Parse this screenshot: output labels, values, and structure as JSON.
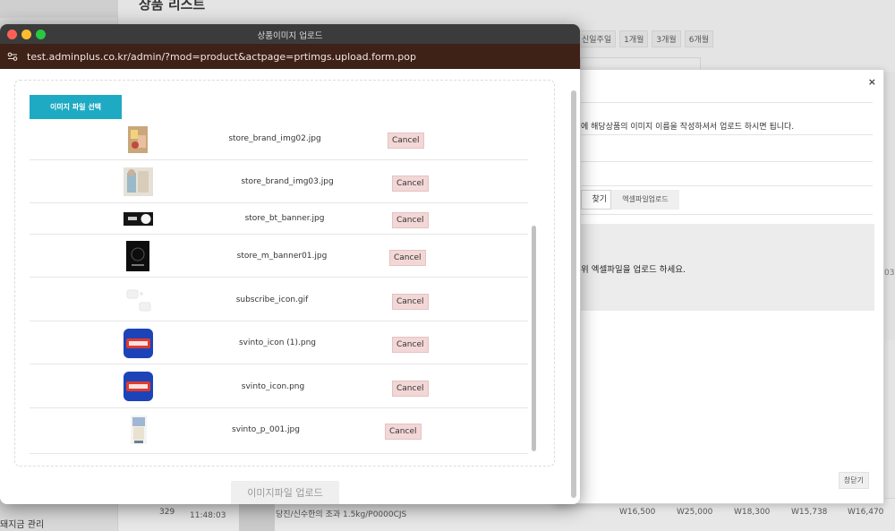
{
  "background": {
    "page_title": "상품 리스트",
    "period_buttons": [
      "신일주일",
      "1개월",
      "3개월",
      "6개월"
    ],
    "sidebar_label": "돼지금 관리",
    "row": {
      "no": "329",
      "time": "11:48:03",
      "product": "당진/신수한의 조과 1.5kg/P0000CJS",
      "prices": [
        "W16,500",
        "W25,000",
        "W18,300",
        "W15,738",
        "W16,470"
      ]
    },
    "right_edge_label": "03"
  },
  "dialog": {
    "close_label": "×",
    "description": "에 해당상품의 이미지 이름을 작성하셔서 업로드 하시면 됩니다.",
    "tab_find": "찾기",
    "tab_excel": "엑셀파일업로드",
    "notice": "위 엑셀파일을 업로드 하세요.",
    "close_button": "창닫기"
  },
  "popup": {
    "window_title": "상품이미지 업로드",
    "url": "test.adminplus.co.kr/admin/?mod=product&actpage=prtimgs.upload.form.pop",
    "select_button": "이미지 파일 선택",
    "upload_button": "이미지파일 업로드",
    "files": [
      {
        "name": "store_brand_img02.jpg",
        "cancel": "Cancel",
        "thumb": "brand-photo-thumb"
      },
      {
        "name": "store_brand_img03.jpg",
        "cancel": "Cancel",
        "thumb": "brand-photo-thumb"
      },
      {
        "name": "store_bt_banner.jpg",
        "cancel": "Cancel",
        "thumb": "dark-banner-thumb"
      },
      {
        "name": "store_m_banner01.jpg",
        "cancel": "Cancel",
        "thumb": "dark-banner-thumb"
      },
      {
        "name": "subscribe_icon.gif",
        "cancel": "Cancel",
        "thumb": "white-icon-thumb"
      },
      {
        "name": "svinto_icon (1).png",
        "cancel": "Cancel",
        "thumb": "svinto-logo-thumb"
      },
      {
        "name": "svinto_icon.png",
        "cancel": "Cancel",
        "thumb": "svinto-logo-thumb"
      },
      {
        "name": "svinto_p_001.jpg",
        "cancel": "Cancel",
        "thumb": "product-photo-thumb"
      }
    ]
  },
  "colors": {
    "select_button": "#1eaac3",
    "cancel_button": "#f3d7d7",
    "url_bar": "#3e2117",
    "title_bar": "#3b3b3b",
    "svinto_blue": "#1c44b8",
    "svinto_red": "#e03a2f"
  }
}
